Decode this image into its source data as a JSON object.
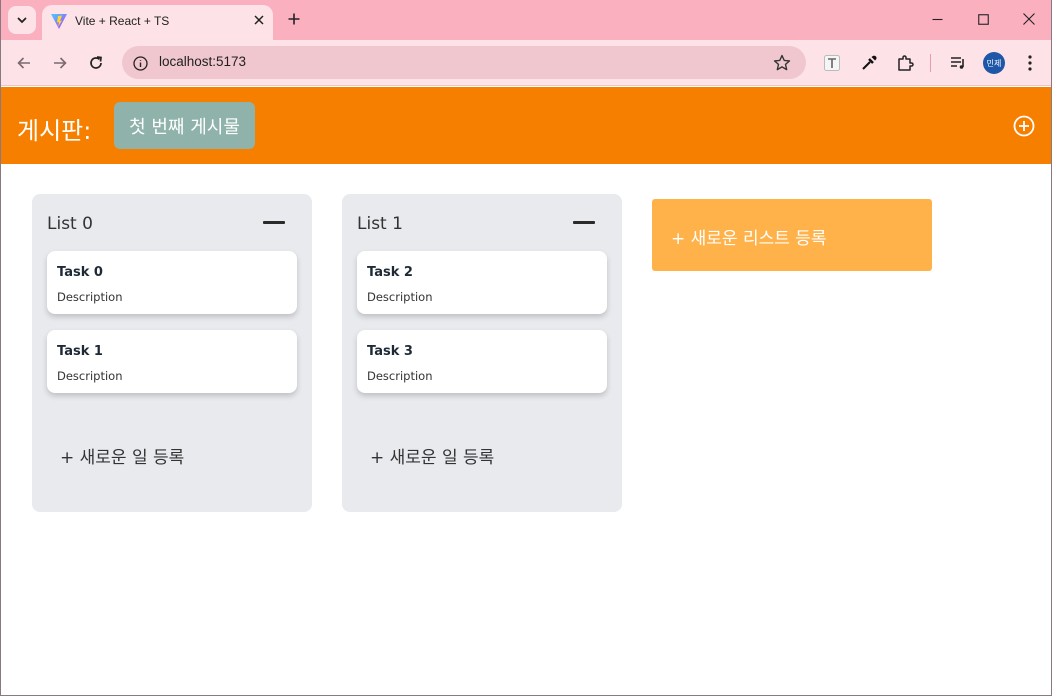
{
  "browser": {
    "tab_title": "Vite + React + TS",
    "url": "localhost:5173",
    "profile_label": "민제"
  },
  "app": {
    "board_label": "게시판:",
    "current_board": "첫 번째 게시물",
    "lists": [
      {
        "title": "List 0",
        "tasks": [
          {
            "title": "Task 0",
            "description": "Description"
          },
          {
            "title": "Task 1",
            "description": "Description"
          }
        ],
        "add_task_label": "+ 새로운 일 등록"
      },
      {
        "title": "List 1",
        "tasks": [
          {
            "title": "Task 2",
            "description": "Description"
          },
          {
            "title": "Task 3",
            "description": "Description"
          }
        ],
        "add_task_label": "+ 새로운 일 등록"
      }
    ],
    "add_list_label": "+ 새로운 리스트 등록"
  },
  "colors": {
    "header": "#f77f00",
    "board_chip": "#8fb3aa",
    "list_bg": "#e9eaee",
    "add_list": "#ffb24a",
    "tabstrip": "#fbb0c0"
  }
}
